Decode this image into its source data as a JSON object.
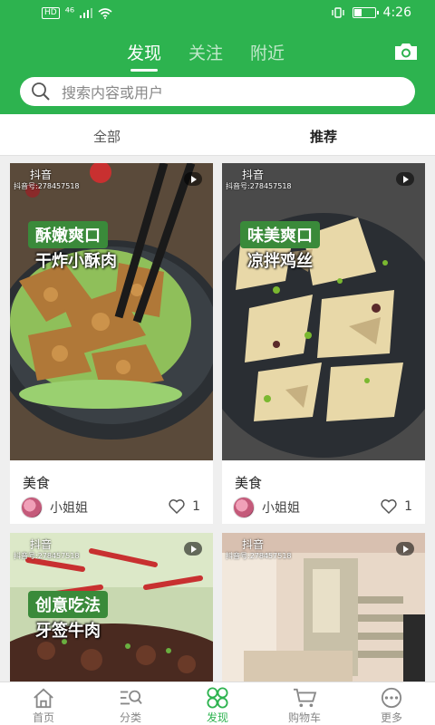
{
  "status_bar": {
    "network": "HD",
    "signal_text": "⁴⁶",
    "time": "4:26"
  },
  "top_tabs": [
    {
      "label": "发现",
      "active": true
    },
    {
      "label": "关注",
      "active": false
    },
    {
      "label": "附近",
      "active": false
    }
  ],
  "search": {
    "placeholder": "搜索内容或用户"
  },
  "sub_tabs": [
    {
      "label": "全部",
      "active": false
    },
    {
      "label": "推荐",
      "active": true
    }
  ],
  "cards": [
    {
      "watermark": "抖音",
      "watermark_id": "抖音号:278457518",
      "caption_line1": "酥嫩爽口",
      "caption_line2": "干炸小酥肉",
      "title": "美食",
      "author": "小姐姐",
      "likes": "1"
    },
    {
      "watermark": "抖音",
      "watermark_id": "抖音号:278457518",
      "caption_line1": "味美爽口",
      "caption_line2": "凉拌鸡丝",
      "title": "美食",
      "author": "小姐姐",
      "likes": "1"
    },
    {
      "watermark": "抖音",
      "watermark_id": "抖音号:278457518",
      "caption_line1": "创意吃法",
      "caption_line2": "牙签牛肉",
      "title": "",
      "author": "",
      "likes": ""
    },
    {
      "watermark": "抖音",
      "watermark_id": "抖音号:278457518",
      "caption_line1": "",
      "caption_line2": "",
      "title": "",
      "author": "",
      "likes": ""
    }
  ],
  "bottom_nav": [
    {
      "label": "首页",
      "icon": "home-icon",
      "active": false
    },
    {
      "label": "分类",
      "icon": "category-icon",
      "active": false
    },
    {
      "label": "发现",
      "icon": "discover-icon",
      "active": true
    },
    {
      "label": "购物车",
      "icon": "cart-icon",
      "active": false
    },
    {
      "label": "更多",
      "icon": "more-icon",
      "active": false
    }
  ],
  "colors": {
    "brand_green": "#2db34f"
  }
}
